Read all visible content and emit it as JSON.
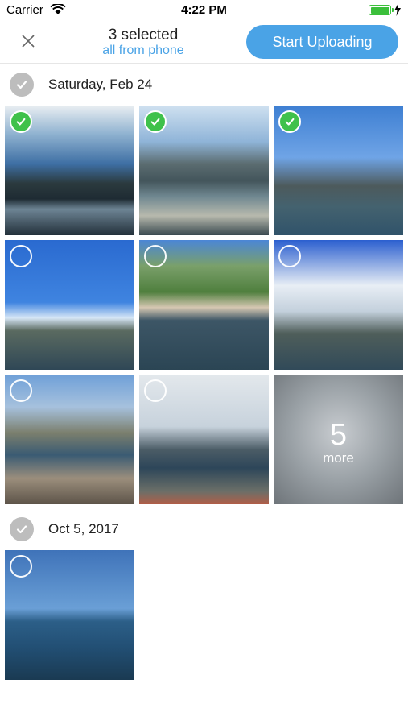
{
  "status_bar": {
    "carrier": "Carrier",
    "time": "4:22 PM"
  },
  "header": {
    "selected_count": "3 selected",
    "subtitle": "all from phone",
    "upload_label": "Start Uploading"
  },
  "sections": [
    {
      "date": "Saturday, Feb 24"
    },
    {
      "date": "Oct 5, 2017"
    }
  ],
  "more_tile": {
    "count": "5",
    "label": "more"
  },
  "colors": {
    "accent": "#4aa3e6",
    "selected": "#3fc14b",
    "section_check": "#bdbdbd"
  },
  "icons": {
    "wifi": "wifi-icon",
    "battery": "battery-icon",
    "charging": "bolt-icon",
    "close": "close-icon",
    "section_select": "checkmark-circle-icon",
    "photo_selected": "checkmark-circle-icon",
    "photo_unselected": "circle-icon"
  }
}
